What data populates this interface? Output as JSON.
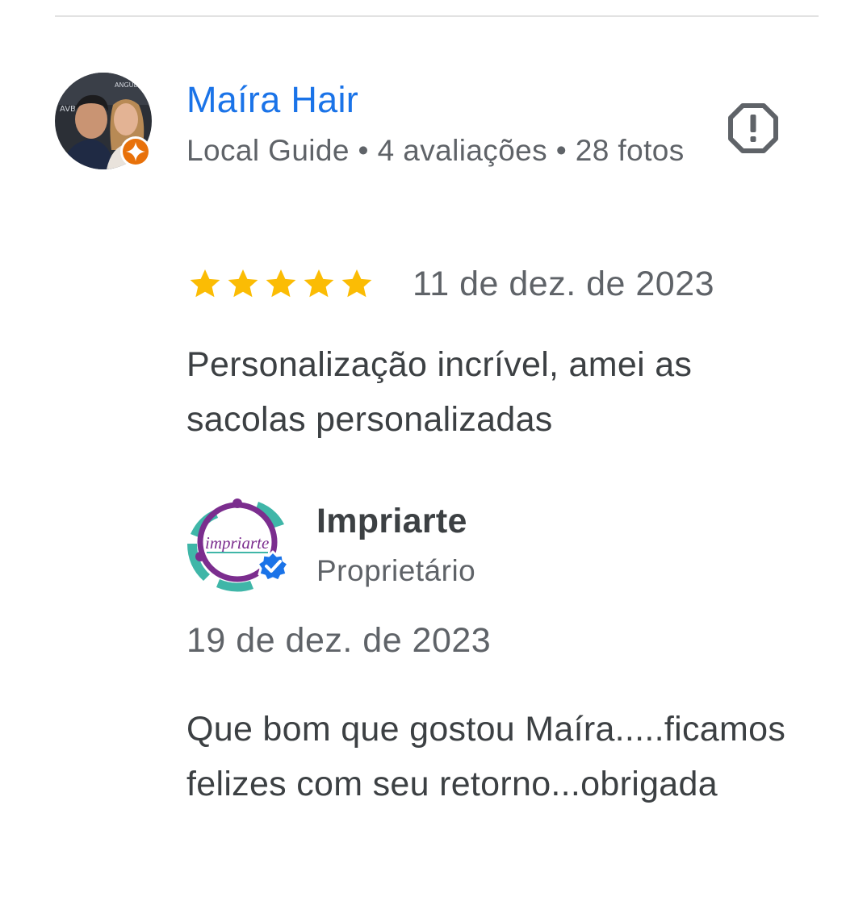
{
  "review": {
    "author": {
      "name": "Maíra Hair",
      "meta": "Local Guide • 4 avaliações • 28 fotos",
      "badge_icon": "local-guide-star-icon",
      "badge_color": "#e8710a"
    },
    "report_icon": "report-octagon-icon",
    "rating": {
      "stars": 5,
      "max": 5,
      "star_color": "#fbbc04"
    },
    "date": "11 de dez. de 2023",
    "text": "Personalização incrível, amei as sacolas personalizadas"
  },
  "owner_response": {
    "name": "Impriarte",
    "role": "Proprietário",
    "logo_text": "impriarte",
    "verified_icon": "verified-check-icon",
    "verified_color": "#1a73e8",
    "date": "19 de dez. de 2023",
    "text": "Que bom que gostou Maíra.....ficamos felizes com seu retorno...obrigada"
  },
  "colors": {
    "link_blue": "#1a73e8",
    "secondary_text": "#5f6368",
    "primary_text": "#3c4043"
  }
}
